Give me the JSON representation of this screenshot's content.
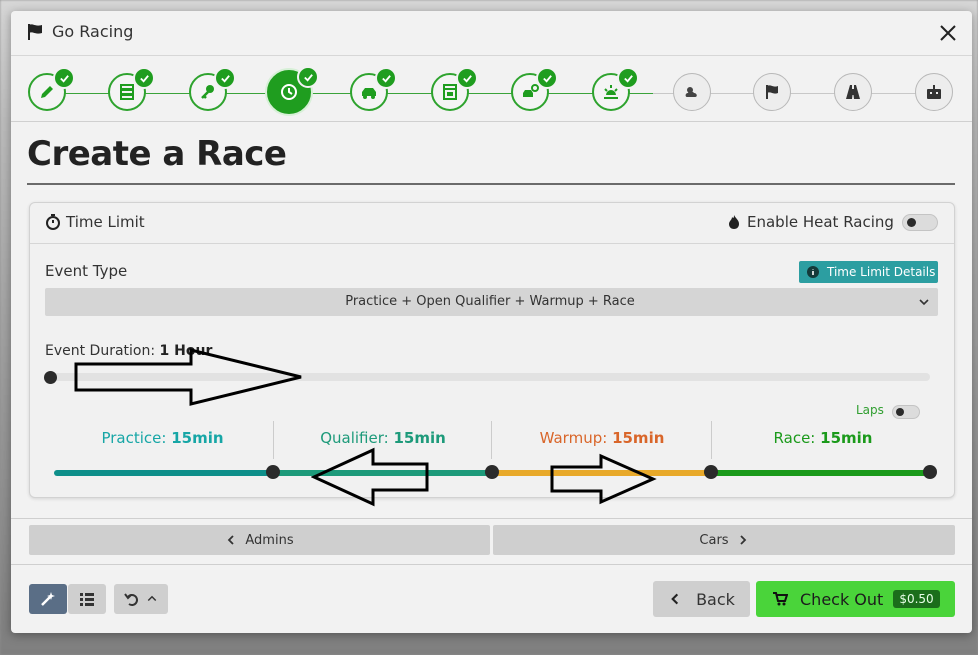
{
  "window": {
    "title": "Go Racing"
  },
  "page": {
    "title": "Create a Race"
  },
  "colors": {
    "accent_green": "#1f9d1f",
    "practice_teal": "#0e8f8a",
    "qualifier_green": "#1d9a7a",
    "warmup_orange": "#e8a92a",
    "race_green": "#1b9a1b",
    "details_teal": "#2c9ea1",
    "checkout_green": "#4ad43a"
  },
  "stepper": {
    "steps": [
      {
        "icon": "pencil-icon",
        "state": "done"
      },
      {
        "icon": "server-icon",
        "state": "done"
      },
      {
        "icon": "key-icon",
        "state": "done"
      },
      {
        "icon": "clock-icon",
        "state": "active"
      },
      {
        "icon": "car-icon",
        "state": "done"
      },
      {
        "icon": "garage-icon",
        "state": "done"
      },
      {
        "icon": "car-settings-icon",
        "state": "done"
      },
      {
        "icon": "sunrise-icon",
        "state": "done"
      },
      {
        "icon": "weather-icon",
        "state": "todo"
      },
      {
        "icon": "flag-icon",
        "state": "todo"
      },
      {
        "icon": "road-icon",
        "state": "todo"
      },
      {
        "icon": "robot-icon",
        "state": "todo"
      }
    ]
  },
  "time_limit": {
    "header_label": "Time Limit",
    "heat_racing_label": "Enable Heat Racing",
    "event_type_label": "Event Type",
    "details_button": "Time Limit Details",
    "event_type_value": "Practice + Open Qualifier + Warmup + Race",
    "duration_label": "Event Duration:",
    "duration_value": "1 Hour",
    "laps_label": "Laps",
    "segments": [
      {
        "name": "Practice:",
        "value": "15min"
      },
      {
        "name": "Qualifier:",
        "value": "15min"
      },
      {
        "name": "Warmup:",
        "value": "15min"
      },
      {
        "name": "Race:",
        "value": "15min"
      }
    ]
  },
  "nav": {
    "prev_label": "Admins",
    "next_label": "Cars"
  },
  "footer": {
    "back_label": "Back",
    "checkout_label": "Check Out",
    "price": "$0.50"
  }
}
